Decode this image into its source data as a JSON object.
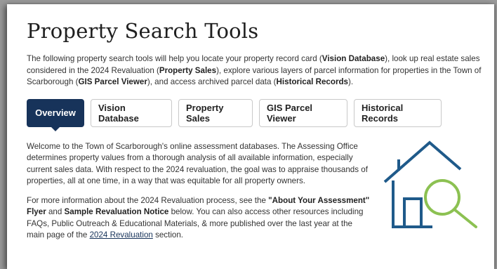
{
  "page": {
    "title": "Property Search Tools",
    "intro": {
      "p1": "The following property search tools will help you locate your property record card (",
      "b1": "Vision Database",
      "p2": "), look up real estate sales considered in the 2024 Revaluation (",
      "b2": "Property Sales",
      "p3": "), explore various layers of parcel information for properties in the Town of Scarborough (",
      "b3": "GIS Parcel Viewer",
      "p4": "), and access archived parcel data (",
      "b4": "Historical Records",
      "p5": ")."
    }
  },
  "tabs": [
    {
      "label": "Overview",
      "active": true
    },
    {
      "label": "Vision Database",
      "active": false
    },
    {
      "label": "Property Sales",
      "active": false
    },
    {
      "label": "GIS Parcel Viewer",
      "active": false
    },
    {
      "label": "Historical Records",
      "active": false
    }
  ],
  "overview": {
    "para1": "Welcome to the Town of Scarborough's online assessment databases. The Assessing Office determines property values from a thorough analysis of all available information, especially current sales data. With respect to the 2024 revaluation, the goal was to appraise thousands of properties, all at one time, in a way that was equitable for all property owners.",
    "para2": {
      "t1": "For more information about the 2024 Revaluation process, see the ",
      "b1": "\"About Your Assessment\" Flyer",
      "t2": " and ",
      "b2": "Sample Revaluation Notice",
      "t3": " below. You can also access other resources including FAQs, Public Outreach & Educational Materials, & more published over the last year at the main page of the ",
      "link": "2024 Revaluation",
      "t4": " section."
    }
  },
  "colors": {
    "accent": "#17335a",
    "house_stroke": "#1f5a8a",
    "magnifier": "#8cc152"
  },
  "icons": {
    "illustration": "house-search-icon"
  }
}
